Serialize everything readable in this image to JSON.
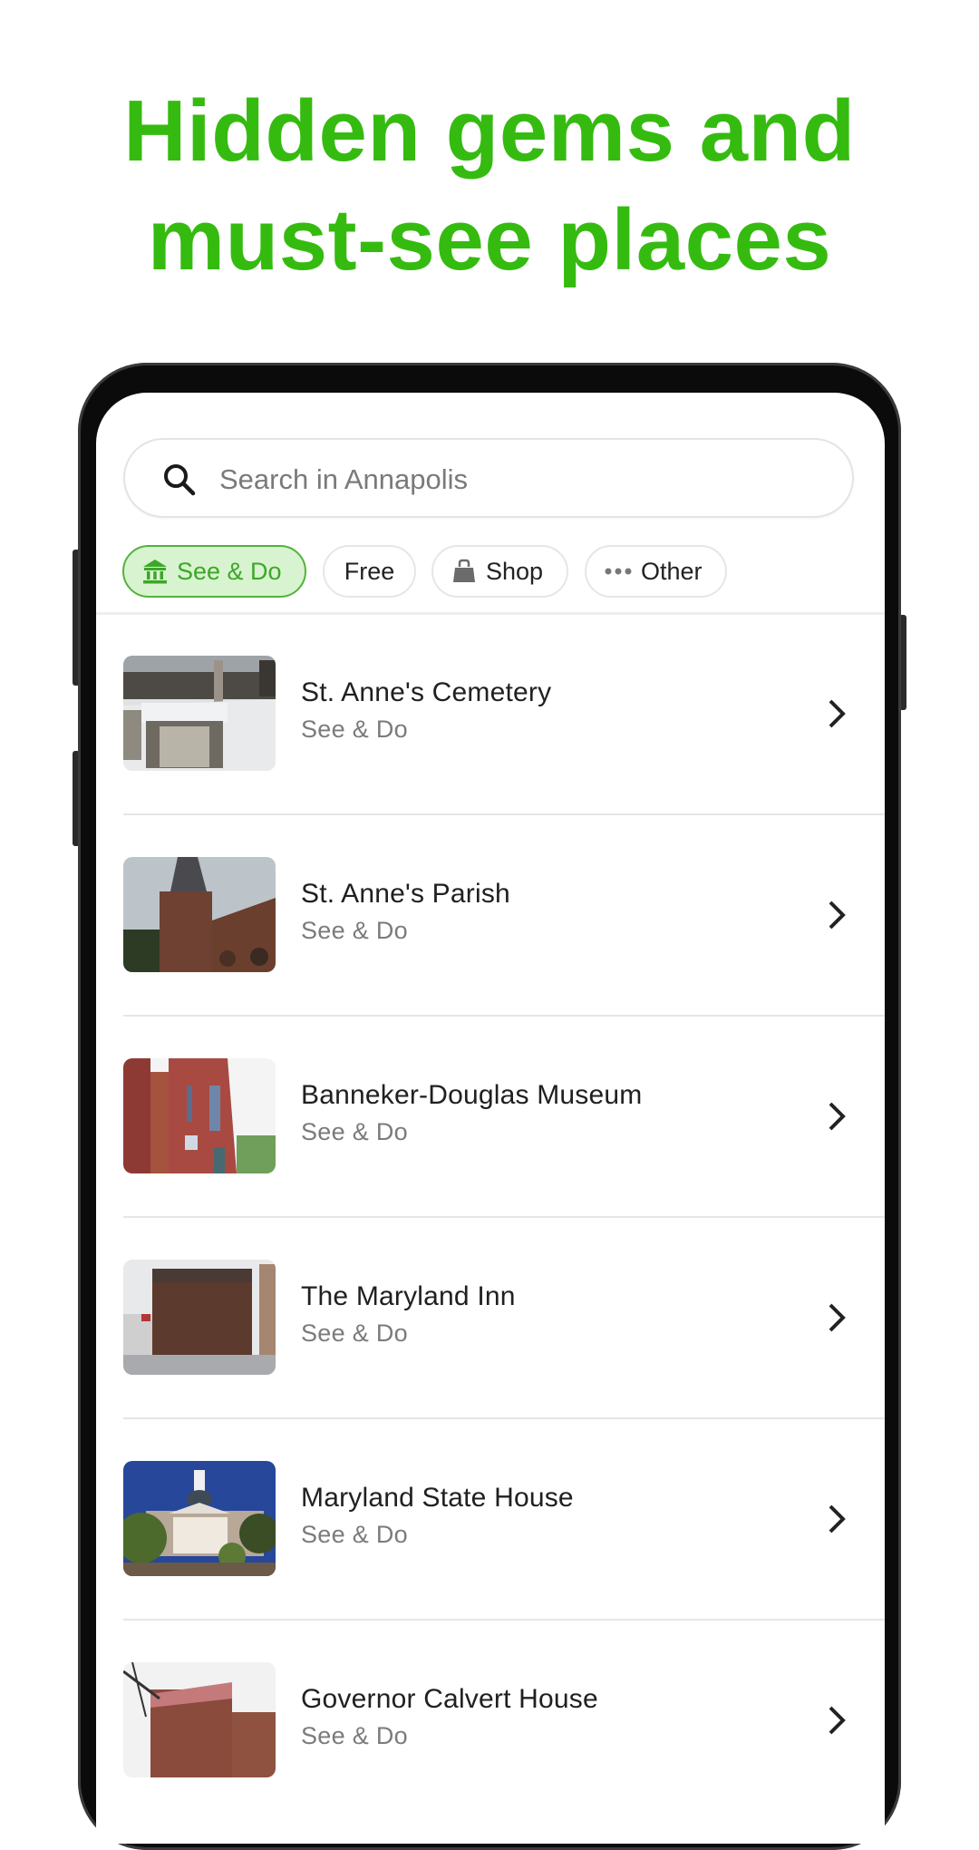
{
  "headline": {
    "line1": "Hidden gems and",
    "line2": "must-see places",
    "color": "#35bb10"
  },
  "search": {
    "icon": "search-icon",
    "placeholder": "Search in Annapolis"
  },
  "chips": [
    {
      "label": "See & Do",
      "icon": "museum-icon",
      "active": true
    },
    {
      "label": "Free",
      "icon": null,
      "active": false
    },
    {
      "label": "Shop",
      "icon": "shopping-bag-icon",
      "active": false
    },
    {
      "label": "Other",
      "icon": "more-dots-icon",
      "active": false
    }
  ],
  "places": [
    {
      "title": "St. Anne's Cemetery",
      "category": "See & Do",
      "thumb": "snowy cemetery tomb"
    },
    {
      "title": "St. Anne's Parish",
      "category": "See & Do",
      "thumb": "brick church steeple"
    },
    {
      "title": "Banneker-Douglas Museum",
      "category": "See & Do",
      "thumb": "red brick church facade"
    },
    {
      "title": "The Maryland Inn",
      "category": "See & Do",
      "thumb": "brick corner hotel"
    },
    {
      "title": "Maryland State House",
      "category": "See & Do",
      "thumb": "domed state house with blue sky"
    },
    {
      "title": "Governor Calvert House",
      "category": "See & Do",
      "thumb": "red brick house with pink roof"
    }
  ],
  "colors": {
    "accent": "#35bb10",
    "chip_active_bg": "#d8f3cf",
    "chip_active_border": "#52b33c",
    "chip_active_text": "#3ca728",
    "title_text": "#202020",
    "subtitle_text": "#7b7b7b"
  }
}
